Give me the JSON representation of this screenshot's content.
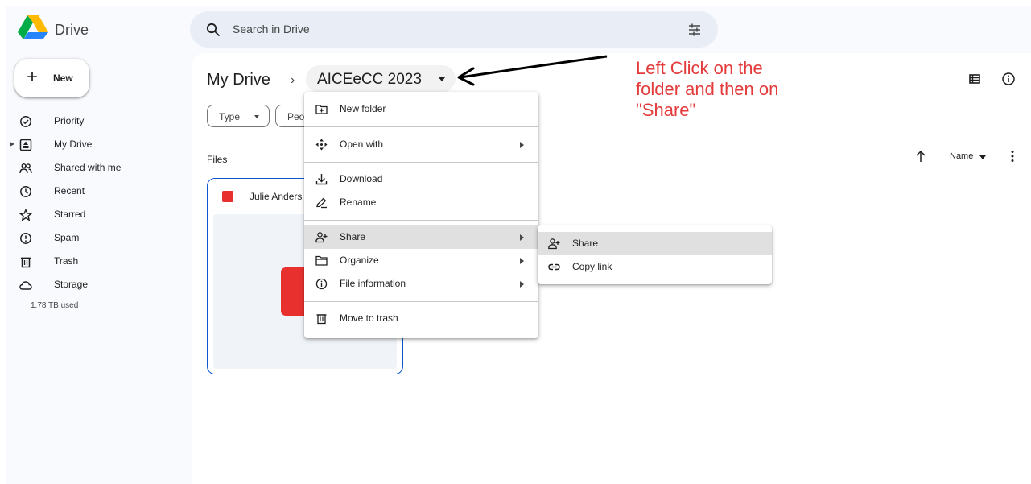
{
  "app": {
    "logo_text": "Drive"
  },
  "search": {
    "placeholder": "Search in Drive"
  },
  "sidebar": {
    "new_label": "New",
    "items": [
      {
        "label": "Priority",
        "icon": "priority-icon"
      },
      {
        "label": "My Drive",
        "icon": "my-drive-icon"
      },
      {
        "label": "Shared with me",
        "icon": "shared-icon"
      },
      {
        "label": "Recent",
        "icon": "clock-icon"
      },
      {
        "label": "Starred",
        "icon": "star-icon"
      },
      {
        "label": "Spam",
        "icon": "spam-icon"
      },
      {
        "label": "Trash",
        "icon": "trash-icon"
      },
      {
        "label": "Storage",
        "icon": "cloud-icon"
      }
    ],
    "storage_used": "1.78 TB used"
  },
  "breadcrumb": {
    "root": "My Drive",
    "separator": "›",
    "folder": "AICEeCC 2023"
  },
  "filters": {
    "type": "Type",
    "people": "Peo"
  },
  "files": {
    "label": "Files",
    "sort_label": "Name",
    "cards": [
      {
        "name": "Julie Anders",
        "icon": "pdf-icon"
      }
    ]
  },
  "context_menu": {
    "items": [
      {
        "label": "New folder",
        "icon": "new-folder-icon",
        "submenu": false
      },
      {
        "label": "Open with",
        "icon": "open-with-icon",
        "submenu": true
      },
      {
        "label": "Download",
        "icon": "download-icon",
        "submenu": false
      },
      {
        "label": "Rename",
        "icon": "rename-icon",
        "submenu": false
      },
      {
        "label": "Share",
        "icon": "share-icon",
        "submenu": true,
        "highlighted": true
      },
      {
        "label": "Organize",
        "icon": "organize-icon",
        "submenu": true
      },
      {
        "label": "File information",
        "icon": "info-icon",
        "submenu": true
      },
      {
        "label": "Move to trash",
        "icon": "trash-icon",
        "submenu": false
      }
    ]
  },
  "share_submenu": {
    "items": [
      {
        "label": "Share",
        "icon": "share-icon",
        "highlighted": true
      },
      {
        "label": "Copy link",
        "icon": "link-icon"
      }
    ]
  },
  "annotation": {
    "lines": [
      "Left Click on the",
      "folder and then on",
      "\"Share\""
    ],
    "color": "#e33b3b"
  },
  "colors": {
    "accent": "#0b57d0",
    "search_bg": "#e9eef6",
    "app_bg": "#f8fafd",
    "highlight": "#e0e0e0"
  }
}
